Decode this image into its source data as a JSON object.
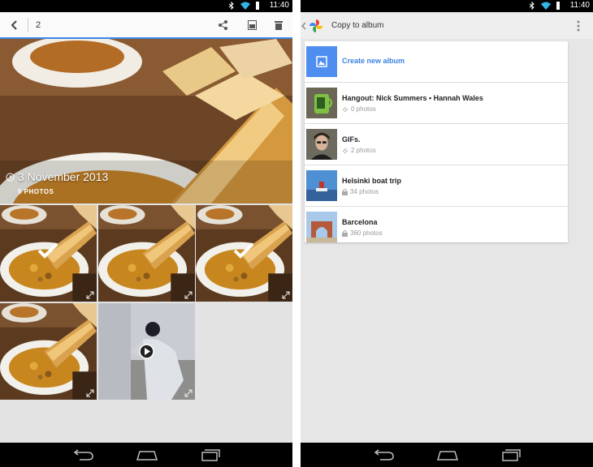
{
  "status": {
    "time": "11:40"
  },
  "gallery": {
    "selected_count": "2",
    "album": {
      "date": "3 November 2013",
      "count": "5 PHOTOS"
    },
    "thumbnails": [
      {
        "kind": "photo",
        "selected": true
      },
      {
        "kind": "photo",
        "selected": false
      },
      {
        "kind": "photo",
        "selected": true
      },
      {
        "kind": "photo",
        "selected": false
      },
      {
        "kind": "video",
        "selected": false
      }
    ]
  },
  "copy_dialog": {
    "title": "Copy to album",
    "create_label": "Create new album",
    "albums": [
      {
        "name": "Hangout: Nick Summers • Hannah Wales",
        "count": "0 photos",
        "privacy": "link-icon"
      },
      {
        "name": "GIFs.",
        "count": "2 photos",
        "privacy": "link-icon"
      },
      {
        "name": "Helsinki boat trip",
        "count": "34 photos",
        "privacy": "lock-icon"
      },
      {
        "name": "Barcelona",
        "count": "360 photos",
        "privacy": "lock-icon"
      }
    ]
  },
  "colors": {
    "accent": "#3a87e6",
    "status_bar": "#000000"
  }
}
